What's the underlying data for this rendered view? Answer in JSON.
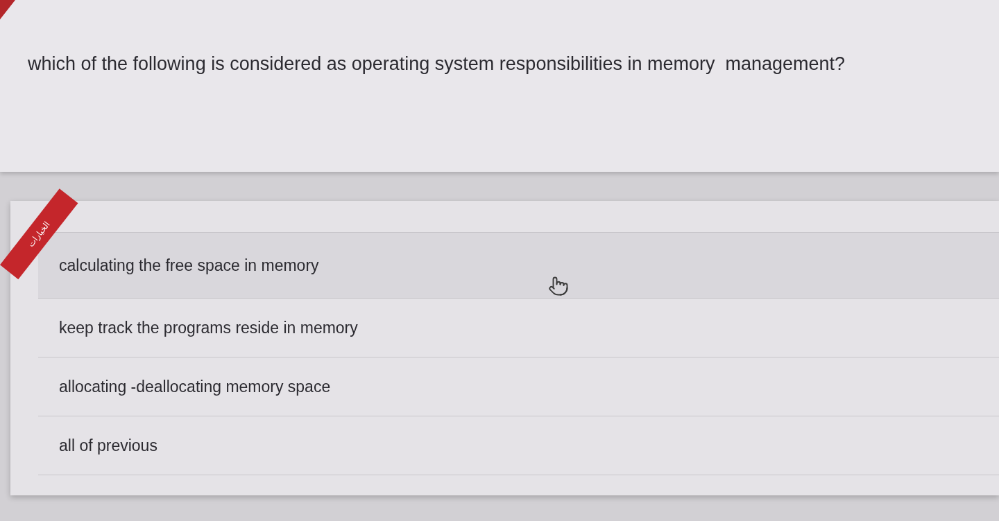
{
  "question": {
    "text": "which of the following is considered as operating system responsibilities in memory  management?"
  },
  "options_panel": {
    "ribbon": "الخيارات",
    "options": [
      {
        "text": "calculating the free space in memory",
        "hovered": true
      },
      {
        "text": "keep track the programs reside in memory",
        "hovered": false
      },
      {
        "text": "allocating -deallocating memory space",
        "hovered": false
      },
      {
        "text": "all of previous",
        "hovered": false
      }
    ]
  }
}
